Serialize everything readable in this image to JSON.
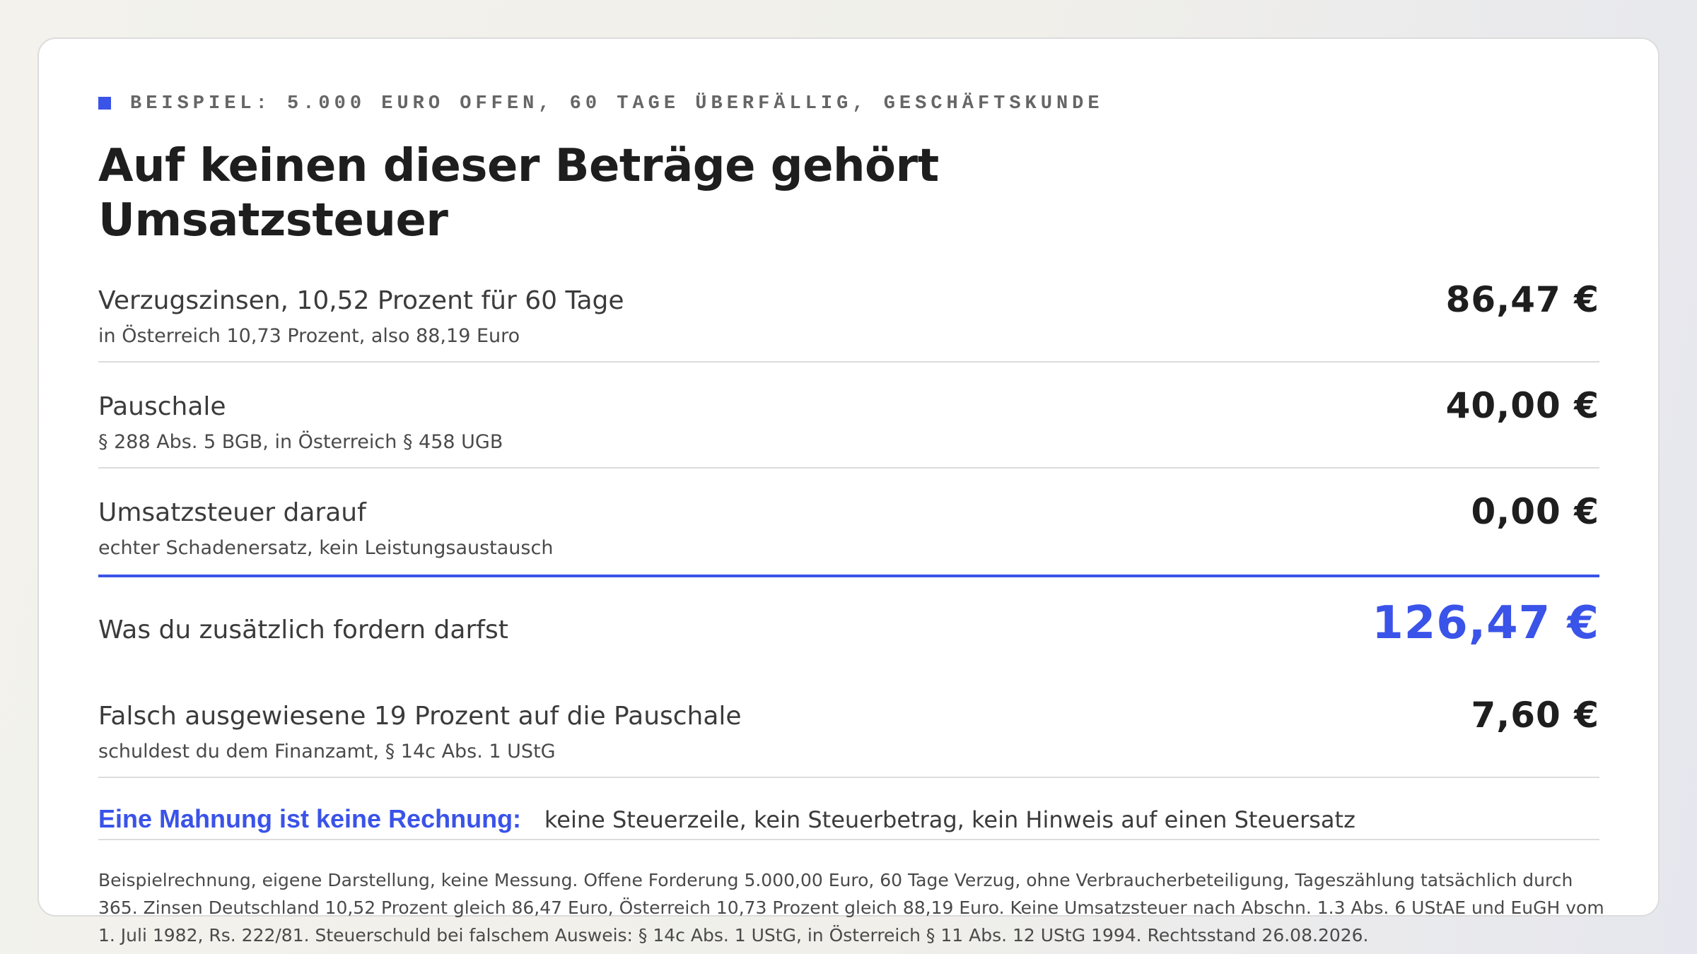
{
  "eyebrow": "BEISPIEL: 5.000 EURO OFFEN, 60 TAGE ÜBERFÄLLIG, GESCHÄFTSKUNDE",
  "title": "Auf keinen dieser Beträge gehört Umsatzsteuer",
  "rows": [
    {
      "label": "Verzugszinsen, 10,52 Prozent für 60 Tage",
      "sub": "in Österreich 10,73 Prozent, also 88,19 Euro",
      "value": "86,47 €"
    },
    {
      "label": "Pauschale",
      "sub": "§ 288 Abs. 5 BGB, in Österreich § 458 UGB",
      "value": "40,00 €"
    },
    {
      "label": "Umsatzsteuer darauf",
      "sub": "echter Schadenersatz, kein Leistungsaustausch",
      "value": "0,00 €"
    }
  ],
  "total": {
    "label": "Was du zusätzlich fordern darfst",
    "value": "126,47 €"
  },
  "extra": {
    "label": "Falsch ausgewiesene 19 Prozent auf die Pauschale",
    "sub": "schuldest du dem Finanzamt, § 14c Abs. 1 UStG",
    "value": "7,60 €"
  },
  "note": {
    "lead": "Eine Mahnung ist keine Rechnung:",
    "text": "keine Steuerzeile, kein Steuerbetrag, kein Hinweis auf einen Steuersatz"
  },
  "footnote": "Beispielrechnung, eigene Darstellung, keine Messung. Offene Forderung 5.000,00 Euro, 60 Tage Verzug, ohne Verbraucherbeteiligung, Tageszählung tatsächlich durch 365. Zinsen Deutschland 10,52 Prozent gleich 86,47 Euro, Österreich 10,73 Prozent gleich 88,19 Euro. Keine Umsatzsteuer nach Abschn. 1.3 Abs. 6 UStAE und EuGH vom 1. Juli 1982, Rs. 222/81. Steuerschuld bei falschem Ausweis: § 14c Abs. 1 UStG, in Österreich § 11 Abs. 12 UStG 1994. Rechtsstand 26.08.2026.",
  "colors": {
    "accent": "#3a53e8",
    "text": "#1e1e1e",
    "muted": "#4a4a4a",
    "divider": "#dcdcdc"
  }
}
